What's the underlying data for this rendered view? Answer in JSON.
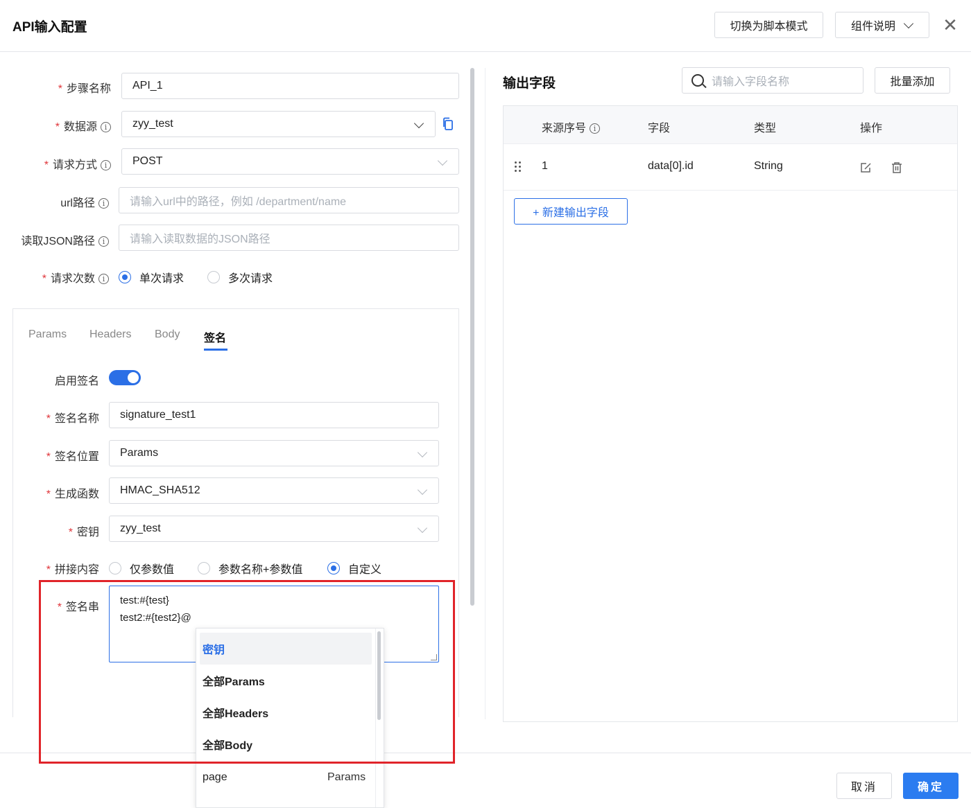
{
  "header": {
    "title": "API输入配置",
    "script_mode_label": "切换为脚本模式",
    "help_label": "组件说明",
    "close_glyph": "✕"
  },
  "form": {
    "step_name": {
      "label": "步骤名称",
      "value": "API_1"
    },
    "datasource": {
      "label": "数据源",
      "value": "zyy_test"
    },
    "method": {
      "label": "请求方式",
      "value": "POST"
    },
    "url_path": {
      "label": "url路径",
      "placeholder": "请输入url中的路径，例如 /department/name"
    },
    "json_path": {
      "label": "读取JSON路径",
      "placeholder": "请输入读取数据的JSON路径"
    },
    "request_count": {
      "label": "请求次数",
      "options": [
        "单次请求",
        "多次请求"
      ],
      "selected": "单次请求"
    }
  },
  "tabs": [
    "Params",
    "Headers",
    "Body",
    "签名"
  ],
  "active_tab": "签名",
  "signature": {
    "enable_label": "启用签名",
    "enabled": true,
    "name": {
      "label": "签名名称",
      "value": "signature_test1"
    },
    "position": {
      "label": "签名位置",
      "value": "Params"
    },
    "function": {
      "label": "生成函数",
      "value": "HMAC_SHA512"
    },
    "key": {
      "label": "密钥",
      "value": "zyy_test"
    },
    "concat": {
      "label": "拼接内容",
      "options": [
        "仅参数值",
        "参数名称+参数值",
        "自定义"
      ],
      "selected": "自定义"
    },
    "sign_string": {
      "label": "签名串",
      "lines": [
        "test:#{test}",
        "test2:#{test2}@"
      ]
    }
  },
  "dropdown": {
    "items": [
      {
        "label": "密钥",
        "right": ""
      },
      {
        "label": "全部Params",
        "right": ""
      },
      {
        "label": "全部Headers",
        "right": ""
      },
      {
        "label": "全部Body",
        "right": ""
      },
      {
        "label": "page",
        "right": "Params"
      }
    ]
  },
  "output": {
    "title": "输出字段",
    "search_placeholder": "请输入字段名称",
    "batch_add_label": "批量添加",
    "columns": [
      "来源序号",
      "字段",
      "类型",
      "操作"
    ],
    "rows": [
      {
        "index": "1",
        "field": "data[0].id",
        "type": "String"
      }
    ],
    "new_field_label": "+ 新建输出字段"
  },
  "footer": {
    "cancel_label": "取消",
    "ok_label": "确定"
  },
  "colors": {
    "accent": "#2b6fe6",
    "required": "#e0363b",
    "highlight": "#e0242a"
  },
  "icons": [
    "copy-icon",
    "info-icon",
    "search-icon",
    "drag-handle-icon",
    "edit-icon",
    "delete-icon",
    "close-icon",
    "chevron-down-icon"
  ]
}
